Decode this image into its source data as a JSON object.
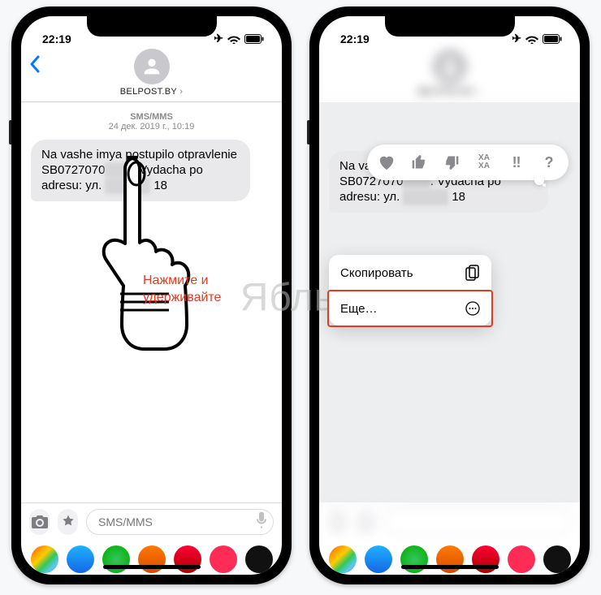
{
  "statusbar": {
    "time": "22:19"
  },
  "header": {
    "sender": "BELPOST.BY"
  },
  "thread": {
    "channel": "SMS/MMS",
    "datetime": "24 дек. 2019 г., 10:19"
  },
  "message": {
    "part1": "Na vashe imya postupilo otpravlenie SB0727070",
    "redacted1": "0000",
    "part2": ". Vydacha po adresu: ул. ",
    "redacted2": "Бaxxxxx",
    "part3": " 18"
  },
  "compose": {
    "placeholder": "SMS/MMS"
  },
  "hint": {
    "line1": "Нажмите и",
    "line2": "удерживайте"
  },
  "tapback": {
    "heart": "♥",
    "thumbs_up": "👍",
    "thumbs_down": "👎",
    "haha": "XA\nXA",
    "exclaim": "‼",
    "question": "?"
  },
  "context_menu": {
    "copy": "Скопировать",
    "more": "Еще…"
  },
  "watermark": "Яблык",
  "app_strip_colors": [
    "linear-gradient(135deg,#ff2d55,#ff9500,#ffcc00,#34c759,#5ac8fa,#af52de)",
    "linear-gradient(180deg,#1fb1ff,#1567e6)",
    "radial-gradient(circle,#34c759,#0a0)",
    "linear-gradient(180deg,#ff7b00,#d84a00)",
    "linear-gradient(180deg,#f03,#a00)",
    "linear-gradient(180deg,#ff2d55,#ff2d55)",
    "linear-gradient(180deg,#111,#111)"
  ]
}
